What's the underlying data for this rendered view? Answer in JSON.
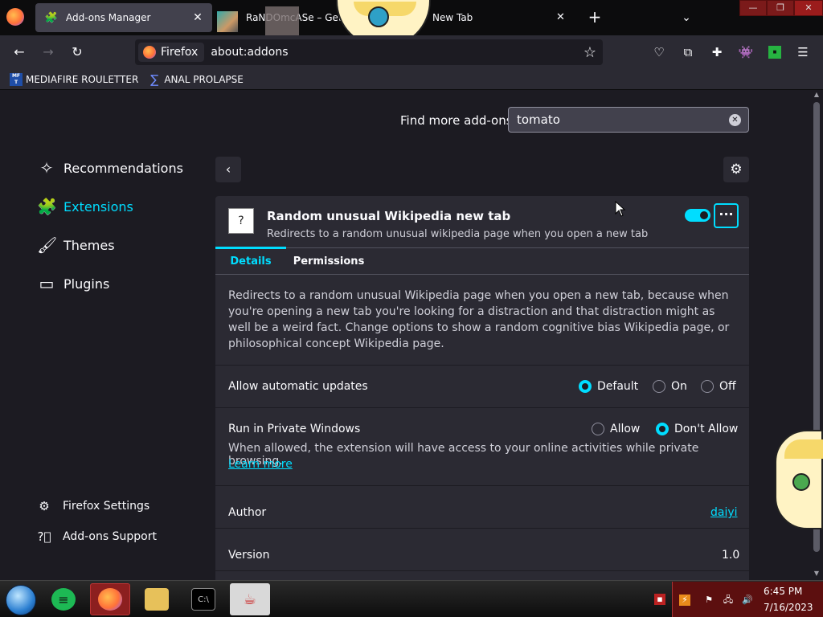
{
  "browser": {
    "tabs": [
      {
        "title": "Add-ons Manager",
        "icon": "puzzle-icon",
        "active": true
      },
      {
        "title": "RaNDOmcASe – Get t",
        "title_tail": "New Tab",
        "active": false
      }
    ],
    "identity_label": "Firefox",
    "url": "about:addons",
    "bookmarks": [
      {
        "label": "MEDIAFIRE ROULETTER",
        "icon_text": "MF T"
      },
      {
        "label": "ANAL PROLAPSE"
      }
    ]
  },
  "addons": {
    "find_label": "Find more add-ons",
    "search_value": "tomato",
    "sidebar": [
      {
        "label": "Recommendations",
        "icon": "sparkle-icon"
      },
      {
        "label": "Extensions",
        "icon": "puzzle-icon",
        "selected": true
      },
      {
        "label": "Themes",
        "icon": "brush-icon"
      },
      {
        "label": "Plugins",
        "icon": "plugin-icon"
      }
    ],
    "footer": [
      {
        "label": "Firefox Settings",
        "icon": "gear-icon"
      },
      {
        "label": "Add-ons Support",
        "icon": "help-icon"
      }
    ],
    "extension": {
      "icon_text": "?",
      "name": "Random unusual Wikipedia new tab",
      "summary": "Redirects to a random unusual wikipedia page when you open a new tab",
      "enabled": true,
      "tabs": [
        "Details",
        "Permissions"
      ],
      "description": "Redirects to a random unusual Wikipedia page when you open a new tab, because when you're opening a new tab you're looking for a distraction and that distraction might as well be a weird fact. Change options to show a random cognitive bias Wikipedia page, or philosophical concept Wikipedia page.",
      "auto_updates": {
        "label": "Allow automatic updates",
        "options": [
          "Default",
          "On",
          "Off"
        ],
        "selected": "Default"
      },
      "private": {
        "label": "Run in Private Windows",
        "options": [
          "Allow",
          "Don't Allow"
        ],
        "selected": "Don't Allow",
        "note": "When allowed, the extension will have access to your online activities while private browsing.",
        "learn_more": "Learn more"
      },
      "author_label": "Author",
      "author": "daiyi",
      "version_label": "Version",
      "version": "1.0"
    }
  },
  "taskbar": {
    "time": "6:45 PM",
    "date": "7/16/2023"
  },
  "colors": {
    "accent": "#00ddff",
    "bg": "#1c1b22",
    "card": "#2b2a33"
  }
}
